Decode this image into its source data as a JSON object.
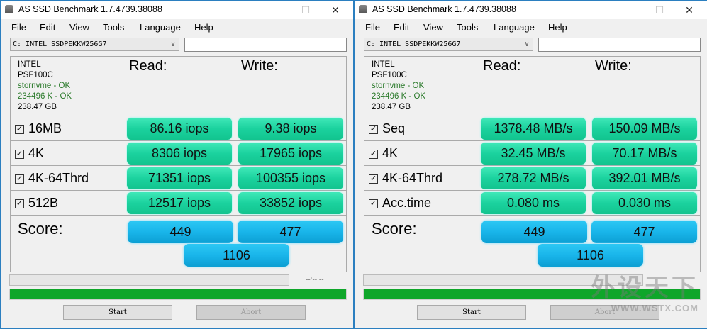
{
  "windows": [
    {
      "title": "AS SSD Benchmark 1.7.4739.38088",
      "menu": [
        "File",
        "Edit",
        "View",
        "Tools",
        "Language",
        "Help"
      ],
      "drive": "C: INTEL SSDPEKKW256G7",
      "info": {
        "vendor": "INTEL",
        "firmware": "PSF100C",
        "driver": "stornvme - OK",
        "align": "234496 K - OK",
        "size": "238.47 GB"
      },
      "read_label": "Read:",
      "write_label": "Write:",
      "rows": [
        {
          "label": "16MB",
          "checked": true,
          "read": "86.16 iops",
          "write": "9.38 iops"
        },
        {
          "label": "4K",
          "checked": true,
          "read": "8306 iops",
          "write": "17965 iops"
        },
        {
          "label": "4K-64Thrd",
          "checked": true,
          "read": "71351 iops",
          "write": "100355 iops"
        },
        {
          "label": "512B",
          "checked": true,
          "read": "12517 iops",
          "write": "33852 iops"
        }
      ],
      "score_label": "Score:",
      "score": {
        "read": "449",
        "write": "477",
        "total": "1106"
      },
      "time": "--:--:--",
      "progress_complete": 1.0,
      "start": "Start",
      "abort": "Abort",
      "checkbox_glyph": "☑"
    },
    {
      "title": "AS SSD Benchmark 1.7.4739.38088",
      "menu": [
        "File",
        "Edit",
        "View",
        "Tools",
        "Language",
        "Help"
      ],
      "drive": "C: INTEL SSDPEKKW256G7",
      "info": {
        "vendor": "INTEL",
        "firmware": "PSF100C",
        "driver": "stornvme - OK",
        "align": "234496 K - OK",
        "size": "238.47 GB"
      },
      "read_label": "Read:",
      "write_label": "Write:",
      "rows": [
        {
          "label": "Seq",
          "checked": true,
          "read": "1378.48 MB/s",
          "write": "150.09 MB/s"
        },
        {
          "label": "4K",
          "checked": true,
          "read": "32.45 MB/s",
          "write": "70.17 MB/s"
        },
        {
          "label": "4K-64Thrd",
          "checked": true,
          "read": "278.72 MB/s",
          "write": "392.01 MB/s"
        },
        {
          "label": "Acc.time",
          "checked": true,
          "read": "0.080 ms",
          "write": "0.030 ms"
        }
      ],
      "score_label": "Score:",
      "score": {
        "read": "449",
        "write": "477",
        "total": "1106"
      },
      "time": "",
      "progress_complete": 1.0,
      "start": "Start",
      "abort": "Abort",
      "checkbox_glyph": "☑"
    }
  ],
  "watermark": {
    "text": "外设天下",
    "url": "WWW.WSTX.COM"
  },
  "colors": {
    "result": "#1bd29e",
    "score": "#19b5ea",
    "progress": "#0fa62a",
    "border": "#2b7fc0"
  }
}
